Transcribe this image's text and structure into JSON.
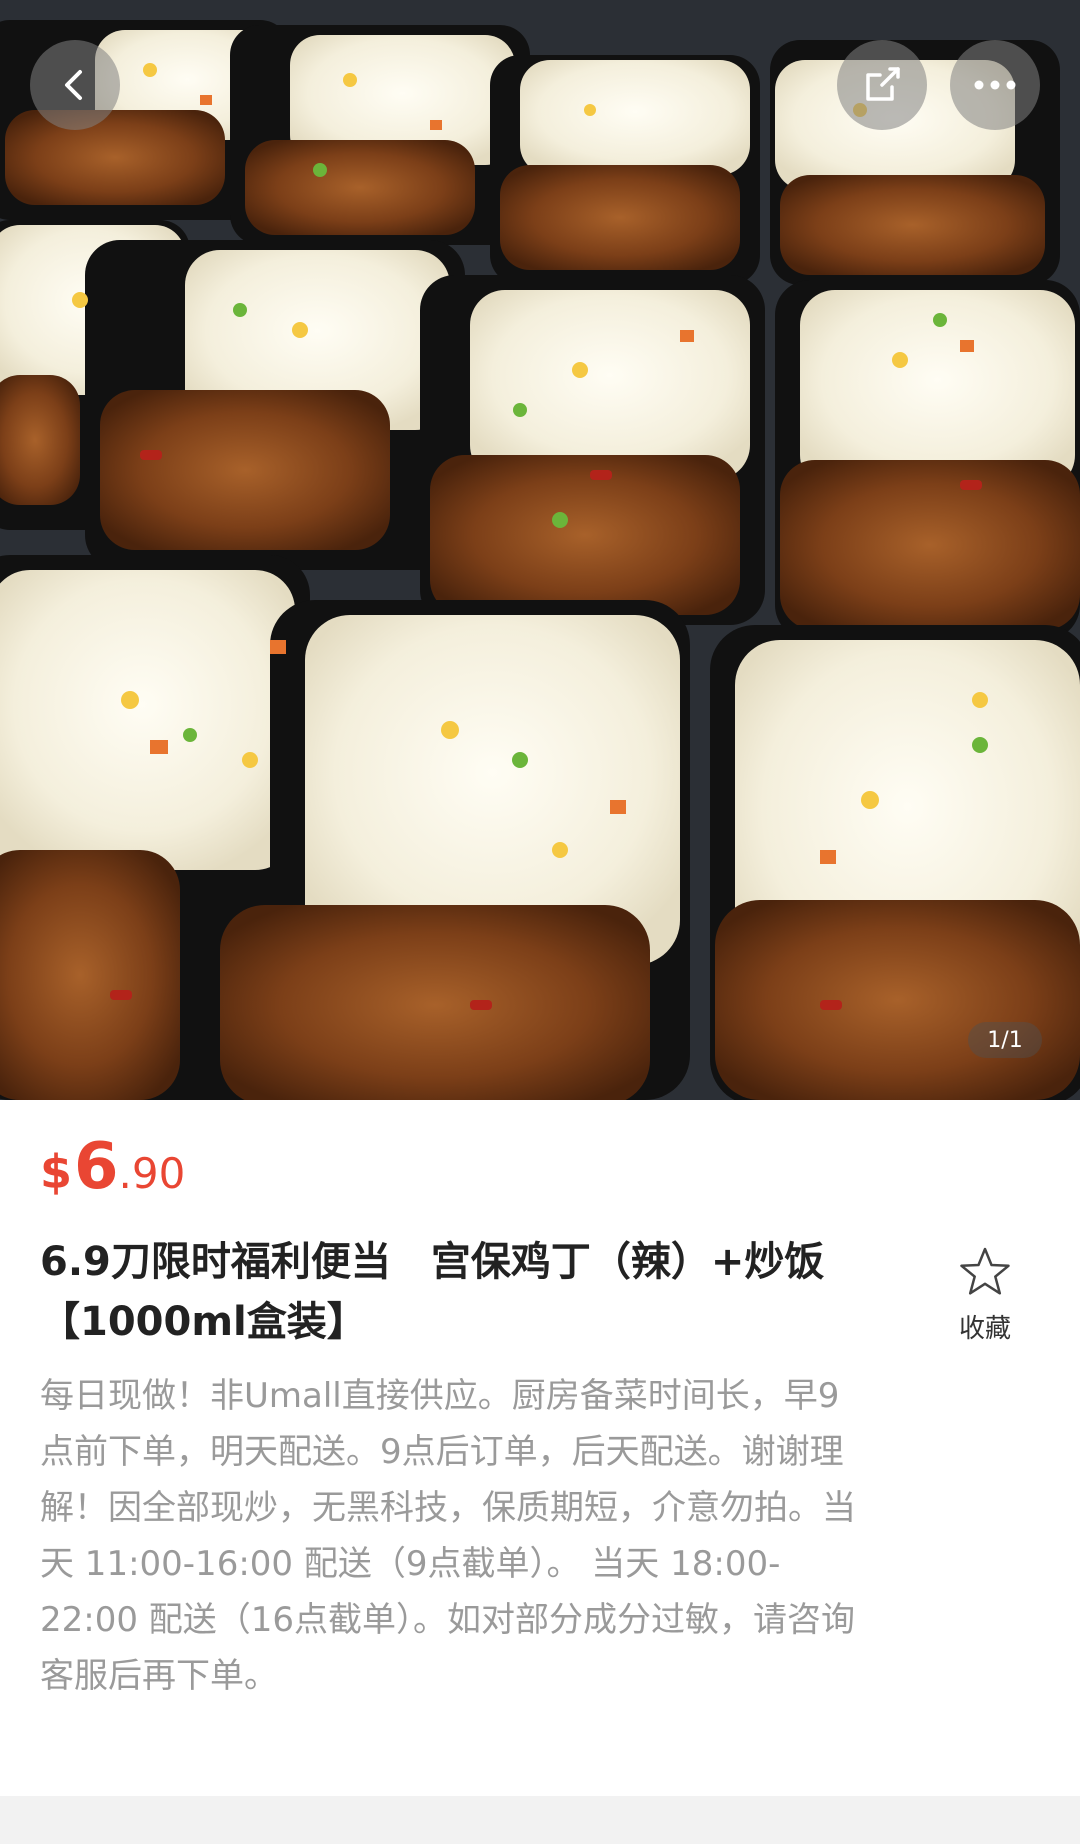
{
  "product_image": {
    "alt_icon": "food-photo",
    "counter": "1/1"
  },
  "nav": {
    "back_icon": "chevron-left-icon",
    "share_icon": "share-icon",
    "more_icon": "more-dots-icon"
  },
  "product": {
    "price_currency": "$",
    "price_integer": "6",
    "price_decimal": ".90",
    "title": "6.9刀限时福利便当　宫保鸡丁（辣）+炒饭【1000ml盒装】",
    "description": "每日现做！非Umall直接供应。厨房备菜时间长，早9点前下单，明天配送。9点后订单，后天配送。谢谢理解！因全部现炒，无黑科技，保质期短，介意勿拍。当天 11:00-16:00 配送（9点截单）。 当天 18:00-22:00 配送（16点截单）。如对部分成分过敏，请咨询客服后再下单。"
  },
  "favorite": {
    "label": "收藏",
    "icon": "star-outline-icon"
  },
  "colors": {
    "price_red": "#e94633",
    "desc_gray": "#9a9a9a"
  }
}
